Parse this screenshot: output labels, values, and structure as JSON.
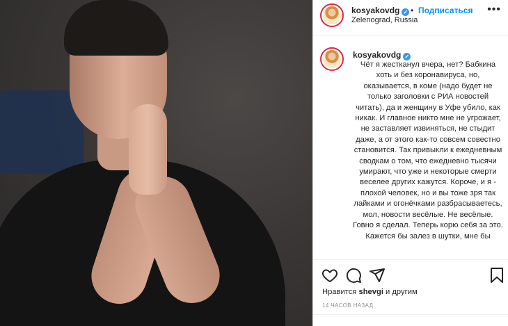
{
  "post": {
    "username": "kosyakovdg",
    "follow_label": "Подписаться",
    "dot": "•",
    "location": "Zelenograd, Russia",
    "more_icon": "more-horizontal-icon",
    "caption": "Чёт я жестканул вчера, нет? Бабкина хоть и без коронавируса, но, оказывается, в коме (надо будет не только заголовки с РИА новостей читать), да и женщину в Уфе убило, как никак. И главное никто мне не угрожает, не заставляет извиняться, не стыдит даже, а от этого как-то совсем совестно становится. Так привыкли к ежедневным сводкам о том, что ежедневно тысячи умирают, что уже и некоторые смерти веселее других кажутся. Короче, и я - плохой человек, но и вы тоже зря так лайками и огонёчками разбрасываетесь, мол, новости весёлые. Не весёлые. Говно я сделал. Теперь корю себя за это. Кажется бы залез в шутки, мне бы",
    "likes_prefix": "Нравится",
    "likes_user": "shevgi",
    "likes_suffix": "и другим",
    "timestamp": "14 ЧАСОВ НАЗАД"
  },
  "icons": {
    "like": "heart-icon",
    "comment": "comment-icon",
    "share": "send-icon",
    "save": "bookmark-icon",
    "verified": "verified-badge-icon"
  },
  "colors": {
    "link": "#0095f6",
    "verified": "#3897f0",
    "text": "#262626",
    "muted": "#8e8e8e"
  }
}
